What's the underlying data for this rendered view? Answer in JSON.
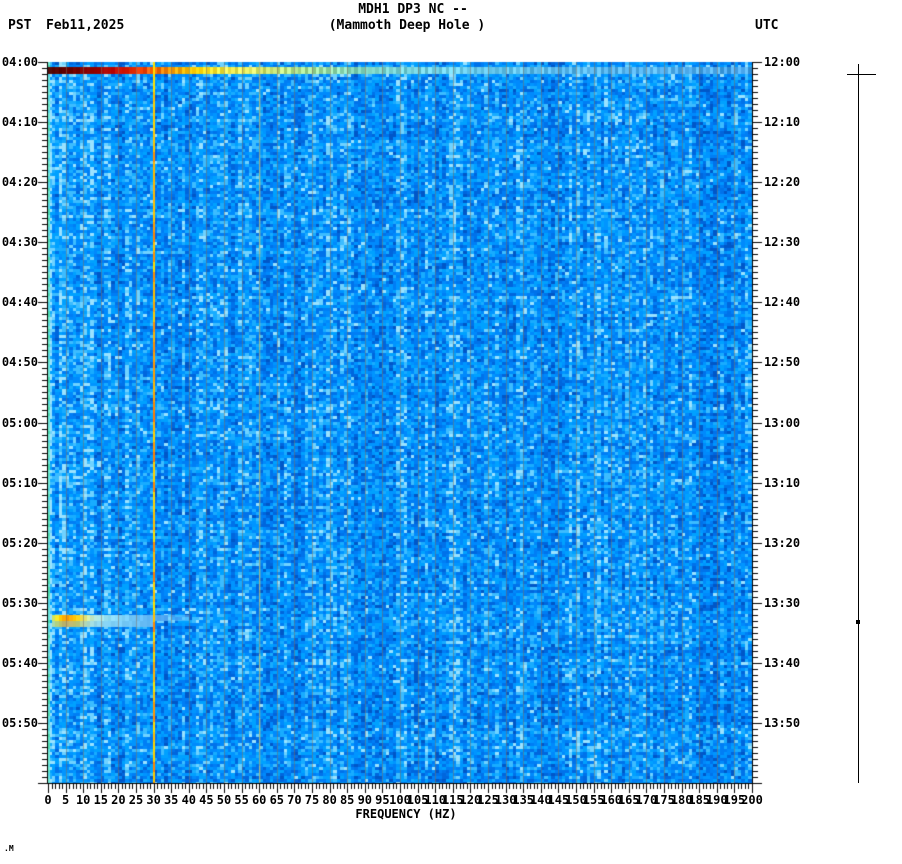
{
  "header": {
    "title": "MDH1 DP3 NC --",
    "subtitle": "(Mammoth Deep Hole )",
    "pst_label": "PST",
    "date_label": "Feb11,2025",
    "utc_label": "UTC"
  },
  "footer": {
    "mark": ".M"
  },
  "chart_data": {
    "type": "heatmap",
    "title": "MDH1 DP3 NC --",
    "subtitle": "(Mammoth Deep Hole )",
    "xlabel": "FREQUENCY (HZ)",
    "x_range_hz": [
      0,
      200
    ],
    "x_major_tick_step_hz": 5,
    "x_minor_tick_step_hz": 1,
    "x_tick_labels": [
      "0",
      "5",
      "10",
      "15",
      "20",
      "25",
      "30",
      "35",
      "40",
      "45",
      "50",
      "55",
      "60",
      "65",
      "70",
      "75",
      "80",
      "85",
      "90",
      "95",
      "100",
      "105",
      "110",
      "115",
      "120",
      "125",
      "130",
      "135",
      "140",
      "145",
      "150",
      "155",
      "160",
      "165",
      "170",
      "175",
      "180",
      "185",
      "190",
      "195",
      "200"
    ],
    "duration_minutes": 120,
    "minor_tick_step_min": 1,
    "major_tick_step_min": 10,
    "left_axis": {
      "timezone_label": "PST",
      "date_label": "Feb11,2025",
      "tick_labels": [
        "04:00",
        "04:10",
        "04:20",
        "04:30",
        "04:40",
        "04:50",
        "05:00",
        "05:10",
        "05:20",
        "05:30",
        "05:40",
        "05:50"
      ]
    },
    "right_axis": {
      "timezone_label": "UTC",
      "tick_labels": [
        "12:00",
        "12:10",
        "12:20",
        "12:30",
        "12:40",
        "12:50",
        "13:00",
        "13:10",
        "13:20",
        "13:30",
        "13:40",
        "13:50"
      ]
    },
    "features": [
      {
        "kind": "broadband-event-row",
        "pst": "04:01",
        "utc": "12:01",
        "minute_start": 1,
        "minute_end": 2,
        "freq_span_hz": [
          0,
          200
        ],
        "description": "strong broadband arrival: dark red at 0-20 Hz grading through red, orange, yellow (~40 Hz), yellow-green (~60 Hz) to light cyan above ~110 Hz"
      },
      {
        "kind": "low-freq-event",
        "pst": "05:33",
        "utc": "13:33",
        "minute_start": 92,
        "minute_end": 94,
        "freq_span_hz": [
          1,
          32
        ],
        "peak_freq_span_hz": [
          3,
          9
        ],
        "description": "small event: yellow-orange core near 3-9 Hz with pale cyan tail to ~30 Hz"
      },
      {
        "kind": "spectral-line",
        "freq_hz": 30,
        "strength": "strong",
        "color": "#ff8800",
        "description": "persistent orange-yellow vertical line at ~30 Hz, full duration"
      },
      {
        "kind": "spectral-line",
        "freq_hz": 60,
        "strength": "weak",
        "color": "#c6ce80",
        "description": "faint khaki vertical line at 60 Hz, full duration"
      },
      {
        "kind": "grid-lines",
        "every_hz": 5,
        "color": "#806e5c",
        "description": "faint warm-gray vertical line every 5 Hz"
      },
      {
        "kind": "edge-column",
        "freq_span_hz": [
          0,
          1
        ],
        "color": "#6fe4c0",
        "description": "teal-green column at 0 Hz edge, full duration"
      }
    ],
    "palette": {
      "background_blues": [
        "#0057c8",
        "#0066dd",
        "#0072ea",
        "#007ef5",
        "#008afc",
        "#0095ff",
        "#00a1ff",
        "#18acff",
        "#3cbcff",
        "#6fd2ff",
        "#9ae2ff"
      ],
      "event_ramp_low_to_high": [
        "#460000",
        "#8b0000",
        "#be0000",
        "#eb2800",
        "#ff7800",
        "#ffbe00",
        "#faeb46",
        "#dceb6e",
        "#aae496",
        "#8ce0be",
        "#78d8dc",
        "#69cdeb",
        "#5fc0f4",
        "#55b4f2",
        "#50acf0"
      ]
    },
    "scale_bar": {
      "present": true,
      "top_crossbar": true,
      "marker_utc": "13:33"
    }
  }
}
